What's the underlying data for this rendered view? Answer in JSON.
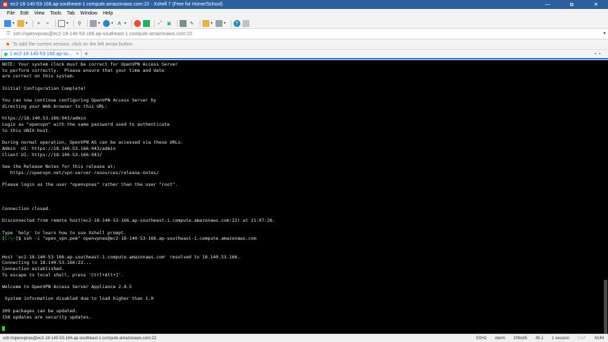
{
  "window": {
    "title": "ec2-18-140-53-166.ap-southeast-1.compute.amazonaws.com:22 - Xshell 7 (Free for Home/School)",
    "minimize": "—",
    "maximize": "⧉",
    "close": "✕"
  },
  "menu": [
    "File",
    "Edit",
    "View",
    "Tools",
    "Tab",
    "Window",
    "Help"
  ],
  "address": {
    "url": "ssh://openvpnas@ec2-18-140-53-166.ap-southeast-1.compute.amazonaws.com:22"
  },
  "hint": {
    "text": "To add the current session, click on the left arrow button."
  },
  "tab": {
    "label": "1 ec2-18-140-53-166.ap-so...",
    "close": "×",
    "add": "+"
  },
  "terminal": {
    "lines_before": [
      "NOTE: Your system clock must be correct for OpenVPN Access Server",
      "to perform correctly.  Please ensure that your time and date",
      "are correct on this system.",
      "",
      "Initial Configuration Complete!",
      "",
      "You can now continue configuring OpenVPN Access Server by",
      "directing your Web browser to this URL:",
      "",
      "https://18.140.53.166:943/admin",
      "Login as \"openvpn\" with the same password used to authenticate",
      "to this UNIX host.",
      "",
      "During normal operation, OpenVPN AS can be accessed via these URLs:",
      "Admin  UI: https://18.140.53.166:943/admin",
      "Client UI: https://18.140.53.166:943/",
      "",
      "See the Release Notes for this release at:",
      "   https://openvpn.net/vpn-server-resources/release-notes/",
      "",
      "Please login as the user \"openvpnas\" rather than the user \"root\".",
      "",
      "",
      "",
      "Connection closed.",
      "",
      "Disconnected from remote host(ec2-18-140-53-166.ap-southeast-1.compute.amazonaws.com:22) at 21:07:26.",
      "",
      "Type `help' to learn how to use Xshell prompt."
    ],
    "prompt_open": "[",
    "prompt_path": "C:\\~",
    "prompt_close": "]$ ",
    "command": "ssh -i \"open_vpn.pem\" openvpnas@ec2-18-140-53-166.ap-southeast-1.compute.amazonaws.com",
    "lines_after": [
      "",
      "",
      "Host 'ec2-18-140-53-166.ap-southeast-1.compute.amazonaws.com' resolved to 18.140.53.166.",
      "Connecting to 18.140.53.166:22...",
      "Connection established.",
      "To escape to local shell, press 'Ctrl+Alt+]'.",
      "",
      "Welcome to OpenVPN Access Server Appliance 2.8.5",
      "",
      " System information disabled due to load higher than 1.0",
      "",
      "209 packages can be updated.",
      "158 updates are security updates.",
      "",
      ""
    ]
  },
  "status": {
    "connection": "ssh://openvpnas@ec2-18-140-53-166.ap-southeast-1.compute.amazonaws.com:22",
    "protocol": "SSH2",
    "terminal": "xterm",
    "size": "209x45",
    "position": "45,1",
    "sessions": "1 session",
    "cap": "CAP",
    "num": "NUM"
  }
}
